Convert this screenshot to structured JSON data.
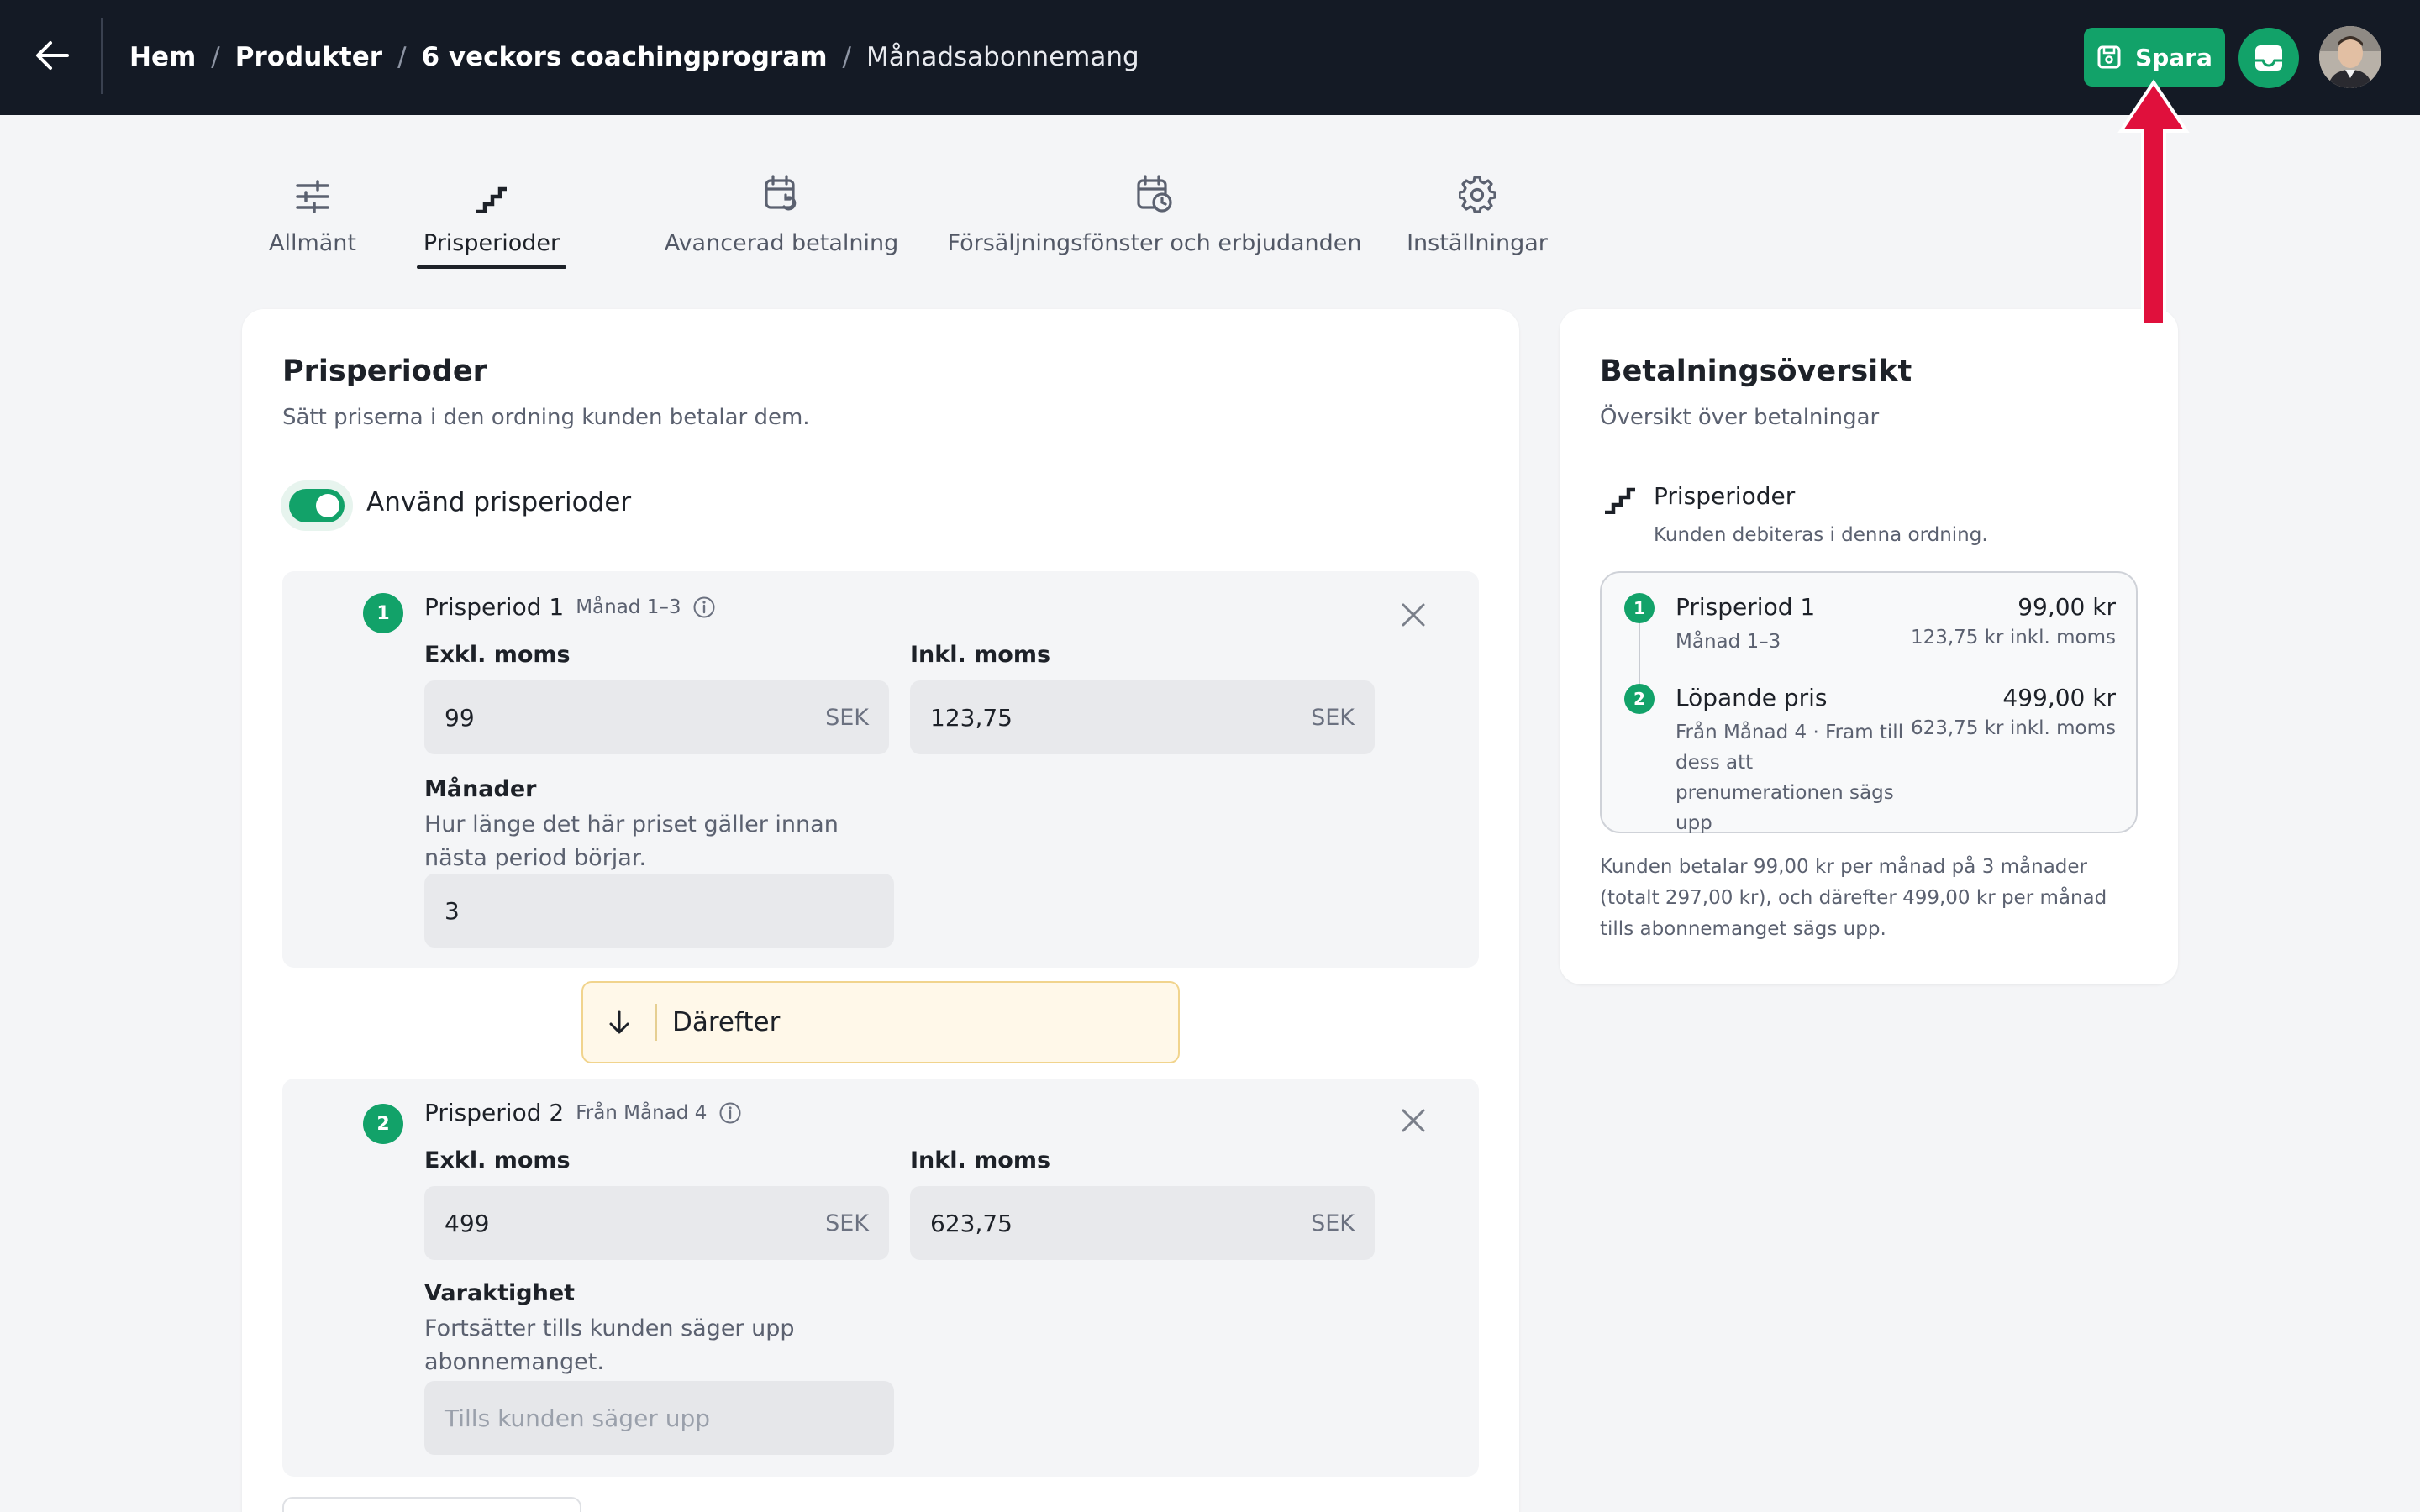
{
  "header": {
    "breadcrumb": [
      "Hem",
      "Produkter",
      "6 veckors coachingprogram"
    ],
    "current": "Månadsabonnemang",
    "save_label": "Spara"
  },
  "tabs": [
    {
      "label": "Allmänt",
      "icon": "sliders-icon"
    },
    {
      "label": "Prisperioder",
      "icon": "stairs-icon",
      "active": true
    },
    {
      "label": "Avancerad betalning",
      "icon": "calendar-refresh-icon"
    },
    {
      "label": "Försäljningsfönster och erbjudanden",
      "icon": "calendar-clock-icon"
    },
    {
      "label": "Inställningar",
      "icon": "gear-icon"
    }
  ],
  "main": {
    "title": "Prisperioder",
    "subtitle": "Sätt priserna i den ordning kunden betalar dem.",
    "toggle_label": "Använd prisperioder",
    "toggle_on": true,
    "periods": [
      {
        "num": "1",
        "title": "Prisperiod 1",
        "range": "Månad 1–3",
        "excl_label": "Exkl. moms",
        "excl_value": "99",
        "incl_label": "Inkl. moms",
        "incl_value": "123,75",
        "currency": "SEK",
        "extra_label": "Månader",
        "extra_help": "Hur länge det här priset gäller innan nästa period börjar.",
        "extra_value": "3"
      },
      {
        "num": "2",
        "title": "Prisperiod 2",
        "range": "Från Månad 4",
        "excl_label": "Exkl. moms",
        "excl_value": "499",
        "incl_label": "Inkl. moms",
        "incl_value": "623,75",
        "currency": "SEK",
        "extra_label": "Varaktighet",
        "extra_help": "Fortsätter tills kunden säger upp abonnemanget.",
        "extra_placeholder": "Tills kunden säger upp"
      }
    ],
    "then_label": "Därefter"
  },
  "side": {
    "title": "Betalningsöversikt",
    "subtitle": "Översikt över betalningar",
    "section_title": "Prisperioder",
    "section_sub": "Kunden debiteras i denna ordning.",
    "rows": [
      {
        "num": "1",
        "name": "Prisperiod 1",
        "price": "99,00 kr",
        "sub": "Månad 1–3",
        "incl": "123,75 kr inkl. moms"
      },
      {
        "num": "2",
        "name": "Löpande pris",
        "price": "499,00 kr",
        "sub": "Från Månad 4 · Fram till dess att prenumerationen sägs upp",
        "incl": "623,75 kr inkl. moms"
      }
    ],
    "note": "Kunden betalar 99,00 kr per månad på 3 månader (totalt 297,00 kr), och därefter 499,00 kr per månad tills abonnemanget sägs upp."
  },
  "colors": {
    "topbar": "#141a25",
    "accent": "#12a269",
    "annotation": "#e0103c",
    "then_bg": "#fff8e9"
  }
}
